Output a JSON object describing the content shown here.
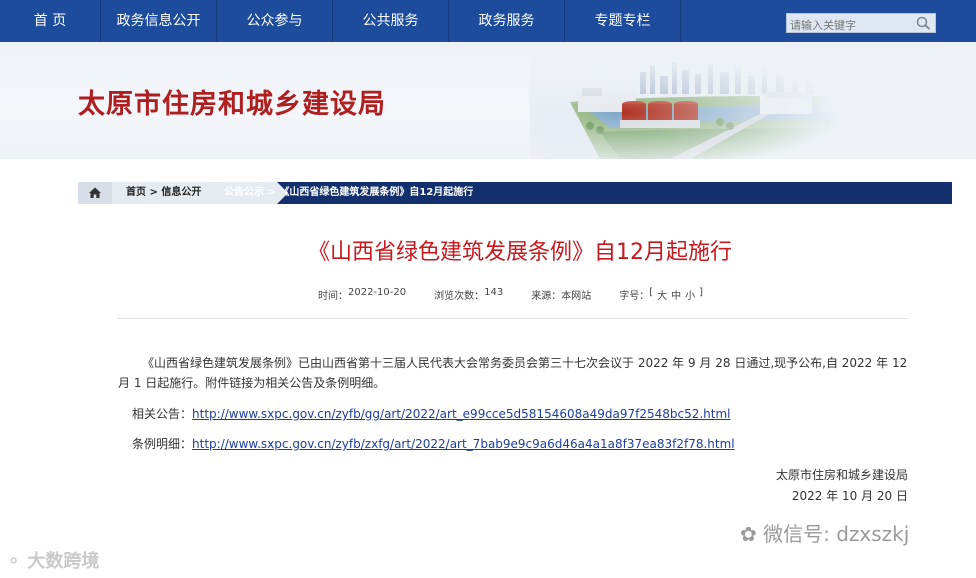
{
  "nav": {
    "items": [
      "首 页",
      "政务信息公开",
      "公众参与",
      "公共服务",
      "政务服务",
      "专题专栏"
    ],
    "search_placeholder": "请输入关键字"
  },
  "banner": {
    "title": "太原市住房和城乡建设局"
  },
  "breadcrumb": {
    "home": "首页",
    "sep1": ">",
    "level1": "信息公开",
    "level2": "公告公示",
    "sep2": ">",
    "current": "《山西省绿色建筑发展条例》自12月起施行"
  },
  "article": {
    "title": "《山西省绿色建筑发展条例》自12月起施行",
    "meta": {
      "time_label": "时间：",
      "time_value": "2022-10-20",
      "views_label": "浏览次数：",
      "views_value": "143",
      "source_label": "来源：",
      "source_value": "本网站",
      "fontsize_label": "字号：",
      "fontsize_open": "[",
      "font_large": "大",
      "font_medium": "中",
      "font_small": "小",
      "fontsize_close": "]"
    },
    "body": "《山西省绿色建筑发展条例》已由山西省第十三届人民代表大会常务委员会第三十七次会议于 2022 年 9 月 28 日通过,现予公布,自 2022 年 12 月 1 日起施行。附件链接为相关公告及条例明细。",
    "link1_label": "相关公告：",
    "link1_url": "http://www.sxpc.gov.cn/zyfb/gg/art/2022/art_e99cce5d58154608a49da97f2548bc52.html",
    "link2_label": "条例明细：",
    "link2_url": "http://www.sxpc.gov.cn/zyfb/zxfg/art/2022/art_7bab9e9c9a6d46a4a1a8f37ea83f2f78.html",
    "signature": "太原市住房和城乡建设局",
    "date": "2022 年 10 月 20 日"
  },
  "watermarks": {
    "left": "大数跨境",
    "right": "微信号: dzxszkj"
  },
  "colors": {
    "nav_bg": "#1d4c9c",
    "title_red": "#c8181e",
    "banner_red": "#b01f1f",
    "link_blue": "#1b3fa0"
  }
}
